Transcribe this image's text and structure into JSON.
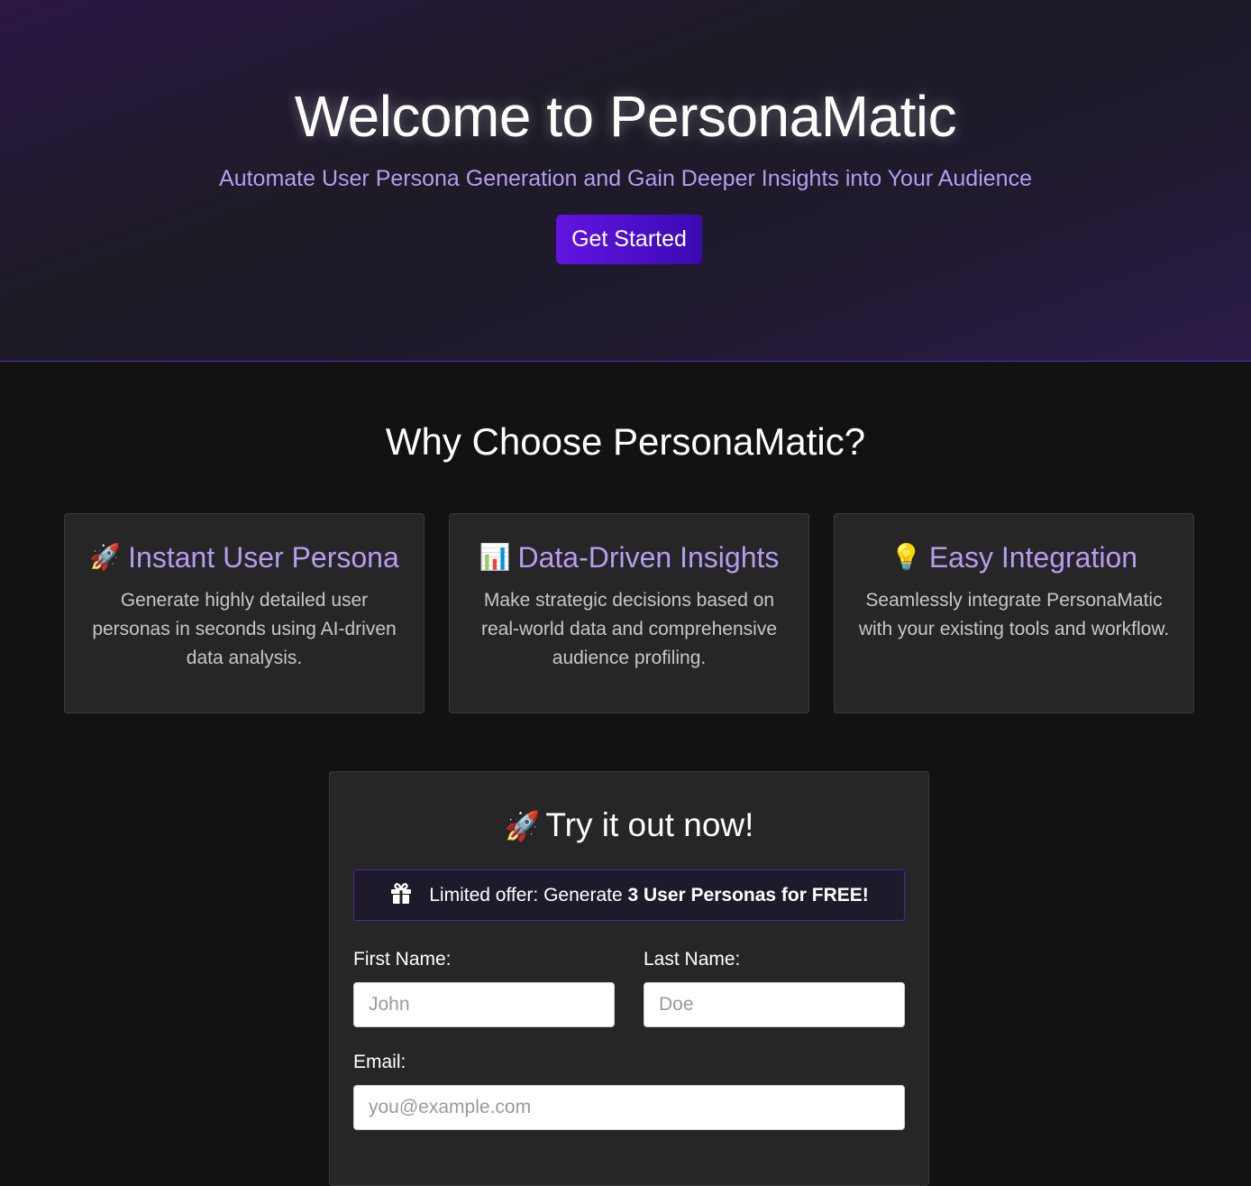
{
  "hero": {
    "title": "Welcome to PersonaMatic",
    "subtitle": "Automate User Persona Generation and Gain Deeper Insights into Your Audience",
    "cta_label": "Get Started"
  },
  "why": {
    "title": "Why Choose PersonaMatic?",
    "features": [
      {
        "icon": "rocket-icon",
        "emoji": "🚀",
        "title": "Instant User Persona",
        "description": "Generate highly detailed user personas in seconds using AI-driven data analysis."
      },
      {
        "icon": "bar-chart-icon",
        "emoji": "📊",
        "title": "Data-Driven Insights",
        "description": "Make strategic decisions based on real-world data and comprehensive audience profiling."
      },
      {
        "icon": "lightbulb-icon",
        "emoji": "💡",
        "title": "Easy Integration",
        "description": "Seamlessly integrate PersonaMatic with your existing tools and workflow."
      }
    ]
  },
  "form": {
    "emoji": "🚀",
    "title": "Try it out now!",
    "offer": {
      "icon": "gift-icon",
      "text_prefix": "Limited offer: Generate ",
      "text_bold": "3 User Personas for FREE!"
    },
    "first_name": {
      "label": "First Name:",
      "placeholder": "John"
    },
    "last_name": {
      "label": "Last Name:",
      "placeholder": "Doe"
    },
    "email": {
      "label": "Email:",
      "placeholder": "you@example.com"
    }
  },
  "colors": {
    "accent": "#b69cf0",
    "button": "#5510d8",
    "background": "#121212",
    "card": "#262626"
  }
}
